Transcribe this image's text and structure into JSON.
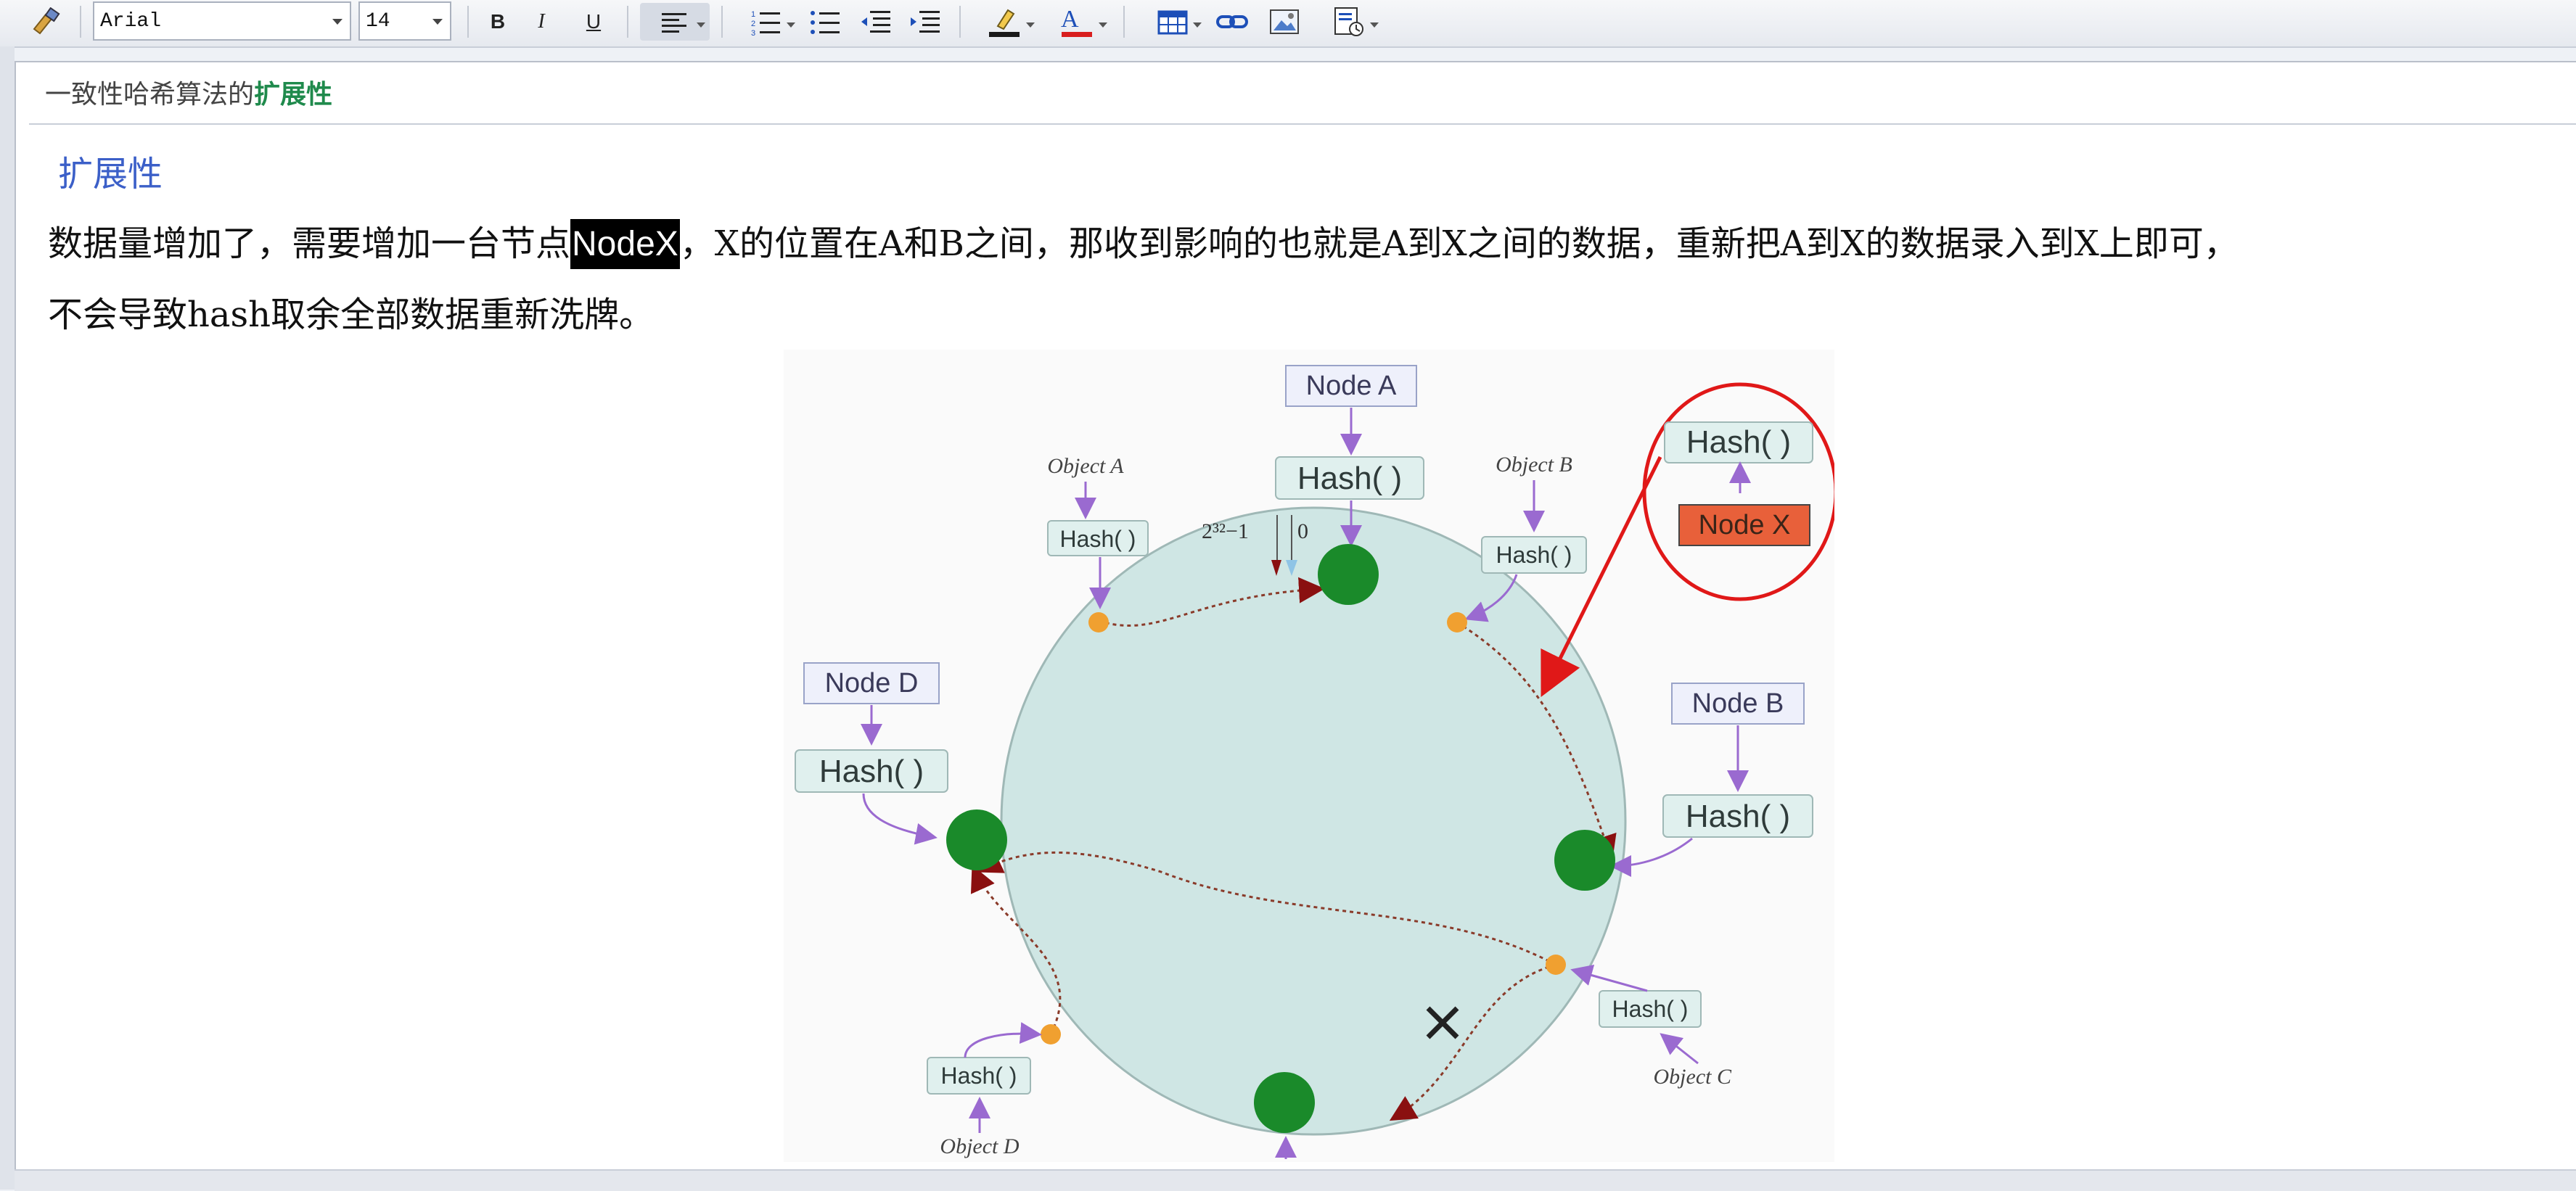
{
  "toolbar": {
    "font_name": "Arial",
    "font_size": "14",
    "bold_label": "B",
    "italic_label": "I",
    "underline_label": "U",
    "text_color_label": "A"
  },
  "breadcrumb": {
    "prefix": "一致性哈希算法的",
    "highlight": "扩展性"
  },
  "content": {
    "heading": "扩展性",
    "line1_before": "数据量增加了，需要增加一台节点",
    "line1_selected": "NodeX",
    "line1_after": "，X的位置在A和B之间，那收到影响的也就是A到X之间的数据，重新把A到X的数据录入到X上即可，",
    "line2": "不会导致hash取余全部数据重新洗牌。"
  },
  "diagram": {
    "node_a": "Node A",
    "node_b": "Node B",
    "node_d": "Node D",
    "node_x": "Node X",
    "hash_label": "Hash( )",
    "object_a": "Object A",
    "object_b": "Object B",
    "object_c": "Object C",
    "object_d": "Object D",
    "ring_max": "2³²−1",
    "ring_zero": "0",
    "colors": {
      "ring_fill": "#cfe6e4",
      "node_green": "#1a8a2a",
      "object_orange": "#f0a030",
      "node_x_fill": "#e8603a",
      "highlight_red": "#e01818",
      "arrow_purple": "#9a6ad0"
    }
  }
}
